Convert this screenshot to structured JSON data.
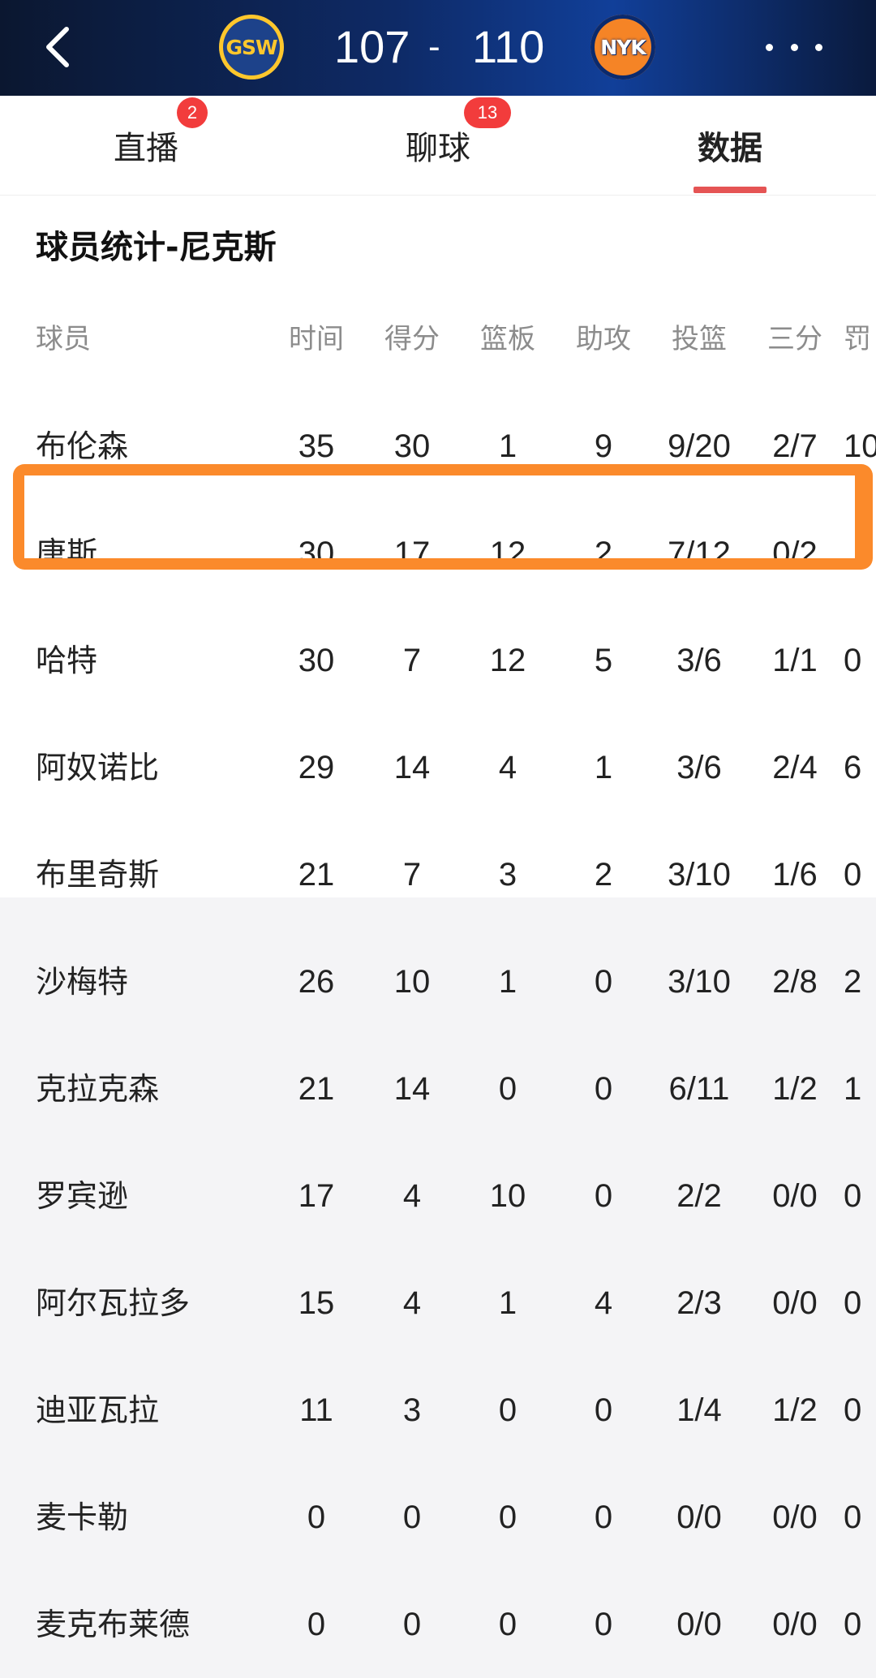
{
  "header": {
    "home_team": "GSW",
    "away_team": "NYK",
    "home_score": "107",
    "separator": "-",
    "away_score": "110"
  },
  "tabs": [
    {
      "label": "直播",
      "badge": "2"
    },
    {
      "label": "聊球",
      "badge": "13"
    },
    {
      "label": "数据",
      "active": true
    }
  ],
  "section": {
    "title": "球员统计-尼克斯"
  },
  "columns": [
    "球员",
    "时间",
    "得分",
    "篮板",
    "助攻",
    "投篮",
    "三分",
    "罚"
  ],
  "starters": [
    {
      "name": "布伦森",
      "min": "35",
      "pts": "30",
      "reb": "1",
      "ast": "9",
      "fg": "9/20",
      "tp": "2/7",
      "ft": "10"
    },
    {
      "name": "唐斯",
      "min": "30",
      "pts": "17",
      "reb": "12",
      "ast": "2",
      "fg": "7/12",
      "tp": "0/2",
      "ft": ""
    },
    {
      "name": "哈特",
      "min": "30",
      "pts": "7",
      "reb": "12",
      "ast": "5",
      "fg": "3/6",
      "tp": "1/1",
      "ft": "0"
    },
    {
      "name": "阿奴诺比",
      "min": "29",
      "pts": "14",
      "reb": "4",
      "ast": "1",
      "fg": "3/6",
      "tp": "2/4",
      "ft": "6"
    },
    {
      "name": "布里奇斯",
      "min": "21",
      "pts": "7",
      "reb": "3",
      "ast": "2",
      "fg": "3/10",
      "tp": "1/6",
      "ft": "0"
    }
  ],
  "bench": [
    {
      "name": "沙梅特",
      "min": "26",
      "pts": "10",
      "reb": "1",
      "ast": "0",
      "fg": "3/10",
      "tp": "2/8",
      "ft": "2"
    },
    {
      "name": "克拉克森",
      "min": "21",
      "pts": "14",
      "reb": "0",
      "ast": "0",
      "fg": "6/11",
      "tp": "1/2",
      "ft": "1"
    },
    {
      "name": "罗宾逊",
      "min": "17",
      "pts": "4",
      "reb": "10",
      "ast": "0",
      "fg": "2/2",
      "tp": "0/0",
      "ft": "0"
    },
    {
      "name": "阿尔瓦拉多",
      "min": "15",
      "pts": "4",
      "reb": "1",
      "ast": "4",
      "fg": "2/3",
      "tp": "0/0",
      "ft": "0"
    },
    {
      "name": "迪亚瓦拉",
      "min": "11",
      "pts": "3",
      "reb": "0",
      "ast": "0",
      "fg": "1/4",
      "tp": "1/2",
      "ft": "0"
    },
    {
      "name": "麦卡勒",
      "min": "0",
      "pts": "0",
      "reb": "0",
      "ast": "0",
      "fg": "0/0",
      "tp": "0/0",
      "ft": "0"
    },
    {
      "name": "麦克布莱德",
      "min": "0",
      "pts": "0",
      "reb": "0",
      "ast": "0",
      "fg": "0/0",
      "tp": "0/0",
      "ft": "0"
    }
  ],
  "colors": {
    "accent_underline": "#e55454",
    "badge": "#f23c3c",
    "highlight": "#fb8a2b",
    "bench_bg": "#f4f4f6"
  },
  "icons": {
    "back": "back-chevron-icon",
    "more": "more-dots-icon"
  }
}
